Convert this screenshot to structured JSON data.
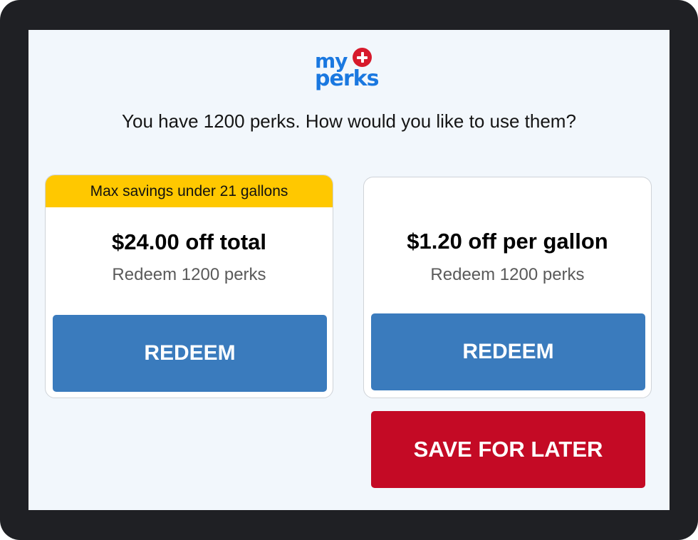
{
  "logo": {
    "line1": "my",
    "line2": "perks",
    "plus_glyph": "+",
    "brand_color": "#1a78e0",
    "accent_color": "#d71a2c"
  },
  "prompt": "You have 1200 perks. How would you like to use them?",
  "offers": [
    {
      "badge": "Max savings under 21 gallons",
      "title": "$24.00 off total",
      "subtitle": "Redeem 1200 perks",
      "button_label": "REDEEM"
    },
    {
      "title": "$1.20 off per gallon",
      "subtitle": "Redeem 1200 perks",
      "button_label": "REDEEM"
    }
  ],
  "save_button_label": "SAVE FOR LATER",
  "colors": {
    "bezel": "#1f2024",
    "screen_bg": "#f2f7fc",
    "badge": "#ffc800",
    "redeem_button": "#3a7bbd",
    "save_button": "#c40a25"
  }
}
